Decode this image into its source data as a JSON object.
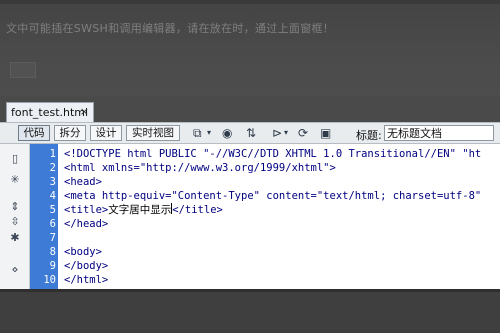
{
  "background": {
    "faint_text": "文中可能插在SWSH和调用编辑器，请在放在时，通过上面窗框！"
  },
  "document_tab": {
    "filename": "font_test.html",
    "close_glyph": "×"
  },
  "toolbar": {
    "view_buttons": [
      "代码",
      "拆分",
      "设计",
      "实时视图"
    ],
    "title_label": "标题:",
    "title_value": "无标题文档"
  },
  "editor": {
    "line_numbers": [
      "1",
      "2",
      "3",
      "4",
      "5",
      "6",
      "7",
      "8",
      "9",
      "10"
    ],
    "lines": [
      "<!DOCTYPE html PUBLIC \"-//W3C//DTD XHTML 1.0 Transitional//EN\" \"ht",
      "<html xmlns=\"http://www.w3.org/1999/xhtml\">",
      "<head>",
      "<meta http-equiv=\"Content-Type\" content=\"text/html; charset=utf-8\"",
      "<title>",
      "</head>",
      "",
      "<body>",
      "</body>",
      "</html>"
    ],
    "title_text": "文字居中显示",
    "title_close": "</title>",
    "active_line": 5
  },
  "colors": {
    "gutter": "#3d7bd6",
    "code_tag": "#000080"
  }
}
